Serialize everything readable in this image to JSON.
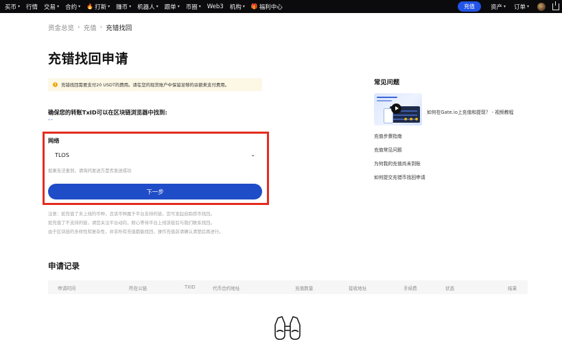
{
  "nav": {
    "items": [
      {
        "label": "买币",
        "caret": true
      },
      {
        "label": "行情",
        "caret": false
      },
      {
        "label": "交易",
        "caret": true
      },
      {
        "label": "合约",
        "caret": true
      },
      {
        "label": "打新",
        "caret": true,
        "icon": "fire-icon"
      },
      {
        "label": "赚币",
        "caret": true
      },
      {
        "label": "机器人",
        "caret": true
      },
      {
        "label": "跟单",
        "caret": true
      },
      {
        "label": "币圈",
        "caret": true
      },
      {
        "label": "Web3",
        "caret": false
      },
      {
        "label": "机构",
        "caret": true
      },
      {
        "label": "福利中心",
        "caret": false,
        "icon": "gift-icon"
      }
    ],
    "deposit_button": "充值",
    "assets": "资产",
    "orders": "订单",
    "caret_glyph": "▾"
  },
  "breadcrumb": {
    "items": [
      "资金总览",
      "充值"
    ],
    "current": "充错找回",
    "separator": "›"
  },
  "page_title": "充错找回申请",
  "notice": {
    "icon": "!",
    "text": "充错找回需要支付20 USDT的费用。请在您的现货账户中保留足够的余额来支付费用。"
  },
  "txid": {
    "title": "确保您的转账TxID可以在区块链浏览器中找到:",
    "value": "--"
  },
  "network": {
    "label": "网络",
    "selected": "TLOS",
    "hint": "如果无法查到，请询问发送方是否发送成功",
    "chevron": "⌄"
  },
  "next_button": "下一步",
  "note_lines": [
    "注意：如充值了未上线的币种，且该币种属于平台支持的链，您可发起自助捞币找回。",
    "如充值了不支持的链，请您关注平台动向，耐心等待平台上线该链后与我们联系找回。",
    "由于区块链的多样性和复杂性，并非所有充值都能找回，操作充值前请确认清楚后再进行。"
  ],
  "faq": {
    "title": "常见问题",
    "video": {
      "title": "如何在Gate.io上充值和提现？ - 视频教程",
      "thumb_text": "How to Deposit / Withdraw"
    },
    "links": [
      "充值步骤指南",
      "充值常见问题",
      "为何我的充值尚未到账",
      "如何提交充错币找回申请"
    ]
  },
  "records": {
    "title": "申请记录",
    "columns": [
      "申请时间",
      "所在公链",
      "TXID",
      "代币合约地址",
      "充值数量",
      "接收地址",
      "手续费",
      "状态",
      "结果"
    ]
  },
  "colors": {
    "accent": "#2354e6",
    "button": "#1f4cc7",
    "highlight": "#e52a1e",
    "notice_bg": "#fdf8e6",
    "warn": "#f0a80b"
  }
}
